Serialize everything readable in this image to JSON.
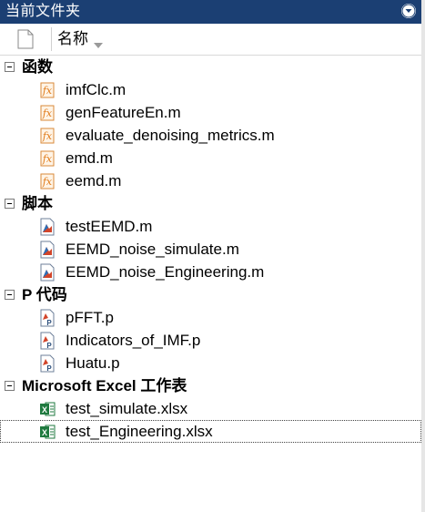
{
  "panel": {
    "title": "当前文件夹"
  },
  "header": {
    "column_name": "名称"
  },
  "groups": [
    {
      "label": "函数",
      "type": "function",
      "items": [
        "imfClc.m",
        "genFeatureEn.m",
        "evaluate_denoising_metrics.m",
        "emd.m",
        "eemd.m"
      ]
    },
    {
      "label": "脚本",
      "type": "script",
      "items": [
        "testEEMD.m",
        "EEMD_noise_simulate.m",
        "EEMD_noise_Engineering.m"
      ]
    },
    {
      "label": "P 代码",
      "type": "pcode",
      "items": [
        "pFFT.p",
        "Indicators_of_IMF.p",
        "Huatu.p"
      ]
    },
    {
      "label": "Microsoft Excel 工作表",
      "type": "excel",
      "items": [
        "test_simulate.xlsx",
        "test_Engineering.xlsx"
      ]
    }
  ],
  "selected_item": "test_Engineering.xlsx",
  "icons": {
    "function": "function-file-icon",
    "script": "script-file-icon",
    "pcode": "pcode-file-icon",
    "excel": "excel-file-icon"
  },
  "colors": {
    "titlebar": "#1b3f73",
    "function_icon": "#e07b1a",
    "excel_icon": "#1f7a3f"
  }
}
